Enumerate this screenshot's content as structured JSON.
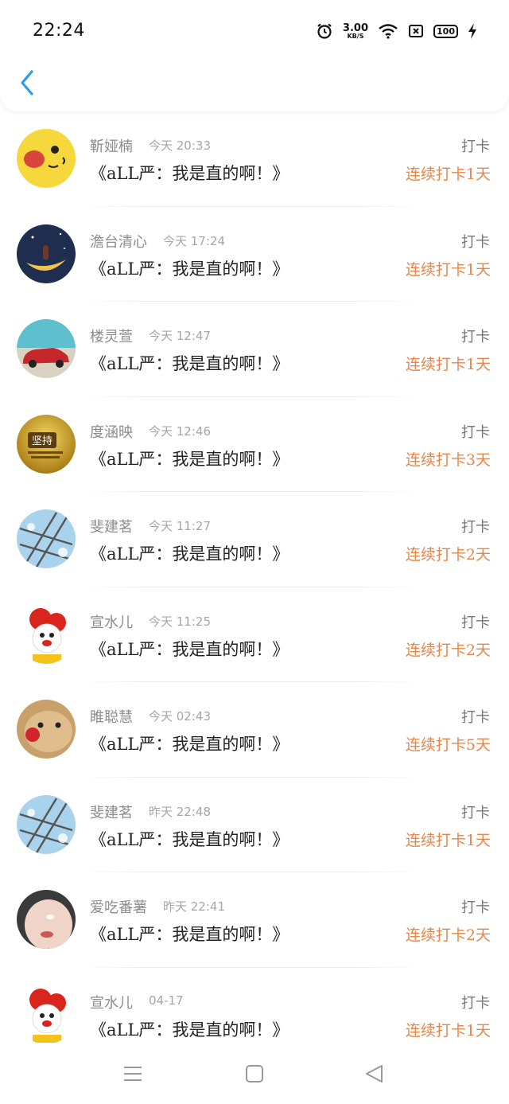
{
  "status_bar": {
    "time": "22:24",
    "net_speed": "3.00",
    "net_unit": "KB/S",
    "battery": "100",
    "icons": [
      "alarm-icon",
      "wifi-icon",
      "sim-off-icon",
      "battery-icon",
      "charging-icon"
    ]
  },
  "header": {
    "back_icon": "chevron-left-icon",
    "accent": "#2f9ee8"
  },
  "colors": {
    "streak": "#e8864a",
    "name": "#8c8c8c",
    "title": "#222222"
  },
  "entries": [
    {
      "name": "靳娅楠",
      "time": "今天 20:33",
      "title": "《aLL严：我是直的啊！》",
      "action": "打卡",
      "streak": "连续打卡1天",
      "avatar": "pikachu"
    },
    {
      "name": "澹台清心",
      "time": "今天 17:24",
      "title": "《aLL严：我是直的啊！》",
      "action": "打卡",
      "streak": "连续打卡1天",
      "avatar": "moon"
    },
    {
      "name": "楼灵萱",
      "time": "今天 12:47",
      "title": "《aLL严：我是直的啊！》",
      "action": "打卡",
      "streak": "连续打卡1天",
      "avatar": "car"
    },
    {
      "name": "度涵映",
      "time": "今天 12:46",
      "title": "《aLL严：我是直的啊！》",
      "action": "打卡",
      "streak": "连续打卡3天",
      "avatar": "badge",
      "avatar_text": "坚持"
    },
    {
      "name": "斐建茗",
      "time": "今天 11:27",
      "title": "《aLL严：我是直的啊！》",
      "action": "打卡",
      "streak": "连续打卡2天",
      "avatar": "net"
    },
    {
      "name": "宣水儿",
      "time": "今天 11:25",
      "title": "《aLL严：我是直的啊！》",
      "action": "打卡",
      "streak": "连续打卡2天",
      "avatar": "clown"
    },
    {
      "name": "睢聪慧",
      "time": "今天 02:43",
      "title": "《aLL严：我是直的啊！》",
      "action": "打卡",
      "streak": "连续打卡5天",
      "avatar": "cat"
    },
    {
      "name": "斐建茗",
      "time": "昨天 22:48",
      "title": "《aLL严：我是直的啊！》",
      "action": "打卡",
      "streak": "连续打卡1天",
      "avatar": "net"
    },
    {
      "name": "爱吃番薯",
      "time": "昨天 22:41",
      "title": "《aLL严：我是直的啊！》",
      "action": "打卡",
      "streak": "连续打卡2天",
      "avatar": "face"
    },
    {
      "name": "宣水儿",
      "time": "04-17",
      "title": "《aLL严：我是直的啊！》",
      "action": "打卡",
      "streak": "连续打卡1天",
      "avatar": "clown"
    }
  ],
  "nav_bar": {
    "icons": [
      "menu-icon",
      "home-icon",
      "back-triangle-icon"
    ]
  }
}
